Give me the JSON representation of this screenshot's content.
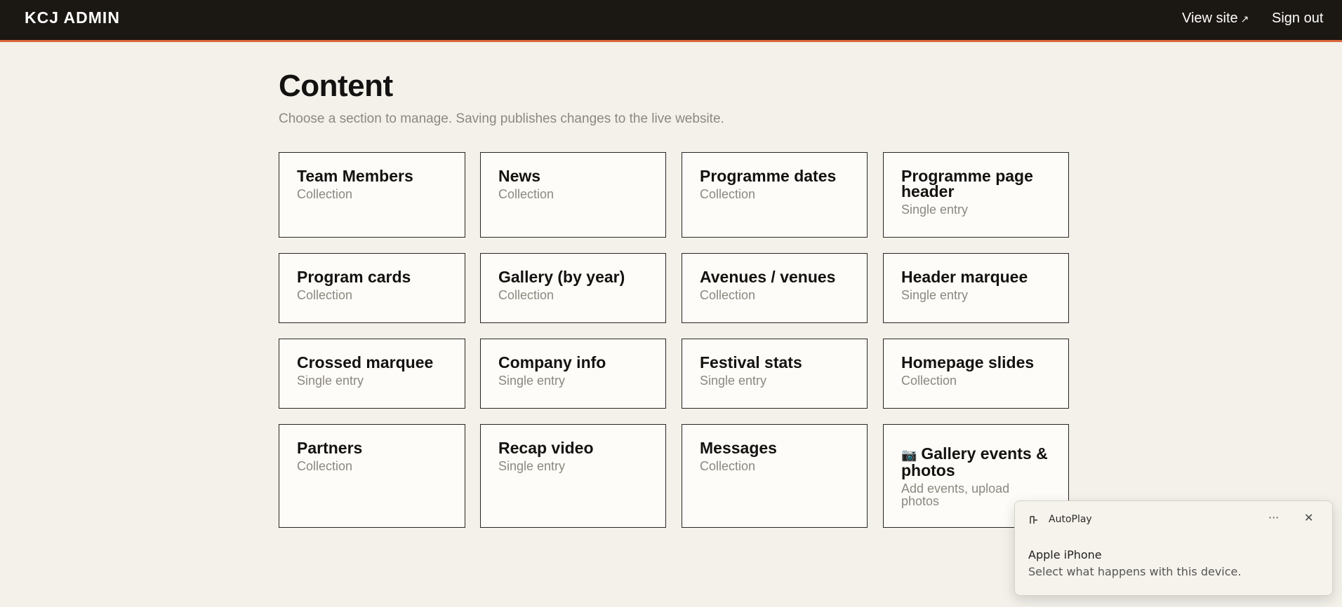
{
  "header": {
    "brand": "KCJ ADMIN",
    "view_site": "View site",
    "view_site_icon": "↗",
    "sign_out": "Sign out"
  },
  "page": {
    "title": "Content",
    "subtitle": "Choose a section to manage. Saving publishes changes to the live website."
  },
  "cards": [
    {
      "title": "Team Members",
      "type": "Collection"
    },
    {
      "title": "News",
      "type": "Collection"
    },
    {
      "title": "Programme dates",
      "type": "Collection"
    },
    {
      "title": "Programme page header",
      "type": "Single entry"
    },
    {
      "title": "Program cards",
      "type": "Collection"
    },
    {
      "title": "Gallery (by year)",
      "type": "Collection"
    },
    {
      "title": "Avenues / venues",
      "type": "Collection"
    },
    {
      "title": "Header marquee",
      "type": "Single entry"
    },
    {
      "title": "Crossed marquee",
      "type": "Single entry"
    },
    {
      "title": "Company info",
      "type": "Single entry"
    },
    {
      "title": "Festival stats",
      "type": "Single entry"
    },
    {
      "title": "Homepage slides",
      "type": "Collection"
    },
    {
      "title": "Partners",
      "type": "Collection"
    },
    {
      "title": "Recap video",
      "type": "Single entry"
    },
    {
      "title": "Messages",
      "type": "Collection"
    },
    {
      "title": "Gallery events & photos",
      "type": "Add events, upload photos",
      "icon": "📷"
    }
  ],
  "notification": {
    "app": "AutoPlay",
    "more_icon": "···",
    "close_icon": "✕",
    "title": "Apple iPhone",
    "body": "Select what happens with this device."
  }
}
